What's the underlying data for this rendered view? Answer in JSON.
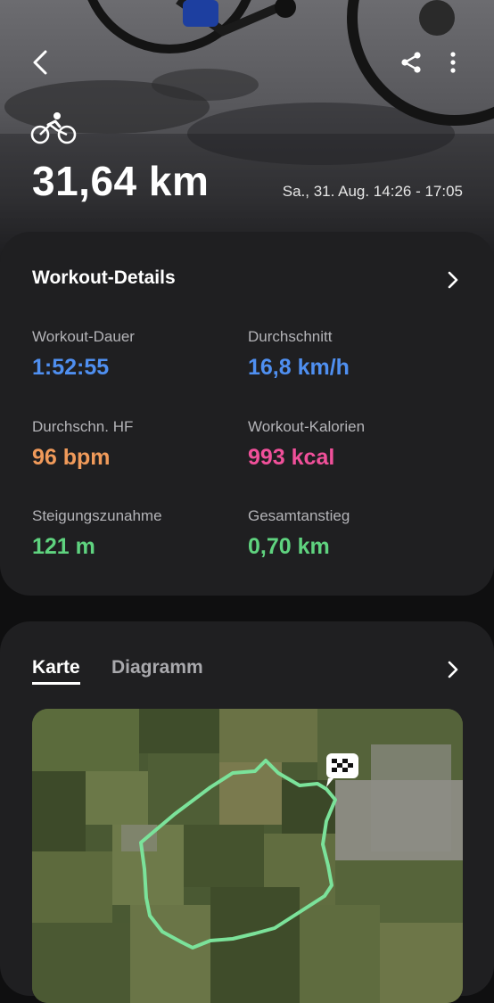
{
  "header": {
    "distance": "31,64 km",
    "datetime": "Sa., 31. Aug. 14:26 - 17:05",
    "sport_icon": "cycling-icon"
  },
  "details": {
    "title": "Workout-Details",
    "stats": [
      {
        "label": "Workout-Dauer",
        "value": "1:52:55",
        "color": "#4f8ff0"
      },
      {
        "label": "Durchschnitt",
        "value": "16,8 km/h",
        "color": "#4f8ff0"
      },
      {
        "label": "Durchschn. HF",
        "value": "96 bpm",
        "color": "#f09a5a"
      },
      {
        "label": "Workout-Kalorien",
        "value": "993 kcal",
        "color": "#f0509a"
      },
      {
        "label": "Steigungszunahme",
        "value": "121 m",
        "color": "#5fd37f"
      },
      {
        "label": "Gesamtanstieg",
        "value": "0,70 km",
        "color": "#5fd37f"
      }
    ]
  },
  "map_section": {
    "tabs": [
      "Karte",
      "Diagramm"
    ],
    "active_tab": "Karte",
    "route_color": "#7be29a"
  }
}
